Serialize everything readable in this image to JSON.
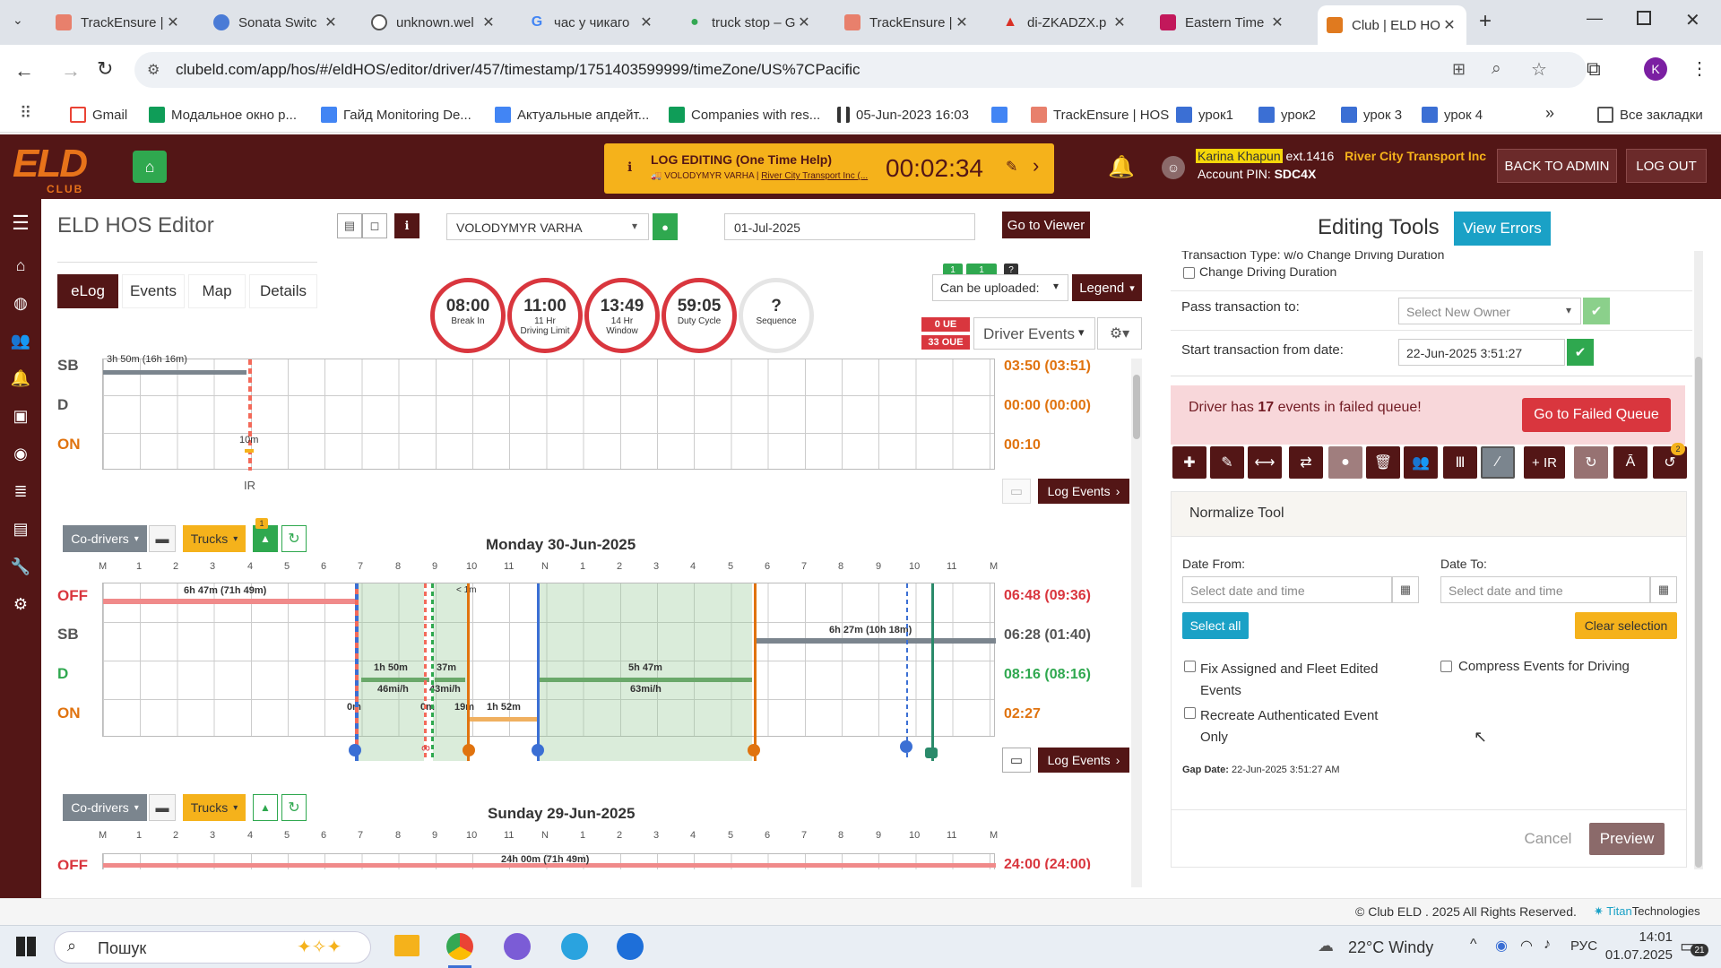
{
  "browser": {
    "tabs": [
      {
        "title": "TrackEnsure |",
        "color": "#e8806c"
      },
      {
        "title": "Sonata Switc",
        "color": "#4a7bd6"
      },
      {
        "title": "unknown.wel",
        "color": "#555555"
      },
      {
        "title": "час у чикаго",
        "color": "#4285f4"
      },
      {
        "title": "truck stop – G",
        "color": "#34a853"
      },
      {
        "title": "TrackEnsure |",
        "color": "#e8806c"
      },
      {
        "title": "di-ZKADZX.p",
        "color": "#d93025"
      },
      {
        "title": "Eastern Time",
        "color": "#c2185b"
      },
      {
        "title": "Club | ELD HO",
        "color": "#e07a1f"
      }
    ],
    "url": "clubeld.com/app/hos/#/eldHOS/editor/driver/457/timestamp/1751403599999/timeZone/US%7CPacific",
    "bookmarks": [
      {
        "label": "Gmail",
        "color": "#ea4335"
      },
      {
        "label": "Модальное окно р...",
        "color": "#0f9d58"
      },
      {
        "label": "Гайд Monitoring De...",
        "color": "#4285f4"
      },
      {
        "label": "Актуальные апдейт...",
        "color": "#4285f4"
      },
      {
        "label": "Companies with res...",
        "color": "#0f9d58"
      },
      {
        "label": "05-Jun-2023 16:03",
        "color": "#333333"
      },
      {
        "label": "",
        "color": "#4285f4"
      },
      {
        "label": "TrackEnsure | HOS",
        "color": "#e8806c"
      },
      {
        "label": "урок1",
        "color": "#3b6fd4"
      },
      {
        "label": "урок2",
        "color": "#3b6fd4"
      },
      {
        "label": "урок 3",
        "color": "#3b6fd4"
      },
      {
        "label": "урок 4",
        "color": "#3b6fd4"
      }
    ],
    "all_bookmarks": "Все закладки"
  },
  "header": {
    "log_editing_title": "LOG EDITING (One Time Help)",
    "log_editing_driver": "VOLODYMYR VARHA",
    "log_editing_company": "River City Transport Inc (...",
    "timer": "00:02:34",
    "user_name": "Karina Khapun",
    "user_ext": "ext.1416",
    "company": "River City Transport Inc",
    "account_pin_label": "Account PIN:",
    "account_pin": "SDC4X",
    "back_to_admin": "BACK TO ADMIN",
    "logout": "LOG OUT"
  },
  "editor": {
    "title": "ELD HOS Editor",
    "driver": "VOLODYMYR VARHA",
    "date": "01-Jul-2025",
    "go_to_viewer": "Go to Viewer",
    "tabs": [
      "eLog",
      "Events",
      "Map",
      "Details"
    ],
    "gauges": [
      {
        "value": "08:00",
        "label": "Break In",
        "l2": ""
      },
      {
        "value": "11:00",
        "label": "11 Hr",
        "l2": "Driving Limit"
      },
      {
        "value": "13:49",
        "label": "14 Hr",
        "l2": "Window"
      },
      {
        "value": "59:05",
        "label": "Duty Cycle",
        "l2": ""
      },
      {
        "value": "?",
        "label": "Sequence",
        "l2": ""
      }
    ],
    "badges": {
      "b1": "1",
      "b2": "1",
      "b3": "?"
    },
    "can_be_uploaded": "Can be uploaded:",
    "legend": "Legend",
    "ue": "0 UE",
    "oue": "33 OUE",
    "driver_events": "Driver Events",
    "top_graph": {
      "rows": [
        "SB",
        "D",
        "ON"
      ],
      "totals": [
        "03:50 (03:51)",
        "00:00 (00:00)",
        "00:10"
      ],
      "labels": {
        "sb_text": "3h 50m (16h 16m)",
        "on_text": "10m",
        "ir": "IR"
      }
    },
    "log_events": "Log Events",
    "co_drivers": "Co-drivers",
    "trucks": "Trucks",
    "notif_badge": "1",
    "day1": {
      "title": "Monday 30-Jun-2025",
      "hours": [
        "M",
        "1",
        "2",
        "3",
        "4",
        "5",
        "6",
        "7",
        "8",
        "9",
        "10",
        "11",
        "N",
        "1",
        "2",
        "3",
        "4",
        "5",
        "6",
        "7",
        "8",
        "9",
        "10",
        "11",
        "M"
      ],
      "rows": [
        "OFF",
        "SB",
        "D",
        "ON"
      ],
      "totals": [
        "06:48 (09:36)",
        "06:28 (01:40)",
        "08:16 (08:16)",
        "02:27"
      ],
      "labels": {
        "off1": "6h 47m (71h 49m)",
        "off2": "< 1m",
        "sb1": "6h 27m (10h 18m)",
        "d1": "1h 50m",
        "d1s": "46mi/h",
        "d2": "37m",
        "d2s": "43mi/h",
        "d3": "5h 47m",
        "d3s": "63mi/h",
        "on1": "0m",
        "on2": "0m",
        "on3": "19m",
        "on4": "1h 52m"
      }
    },
    "day2": {
      "title": "Sunday 29-Jun-2025",
      "off_text": "24h 00m (71h 49m)",
      "off_total": "24:00 (24:00)"
    }
  },
  "tools": {
    "title": "Editing Tools",
    "view_errors": "View Errors",
    "transaction_type": "Transaction Type: w/o Change Driving Duration",
    "change_driving": "Change Driving Duration",
    "pass_to": "Pass transaction to:",
    "select_owner": "Select New Owner",
    "start_from": "Start transaction from date:",
    "start_date": "22-Jun-2025 3:51:27",
    "failed_pre": "Driver has ",
    "failed_count": "17",
    "failed_post": " events in failed queue!",
    "go_failed": "Go to Failed Queue",
    "ir_btn": "+ IR",
    "hist_badge": "2",
    "normalize": "Normalize Tool",
    "date_from": "Date From:",
    "date_to": "Date To:",
    "date_ph": "Select date and time",
    "select_all": "Select all",
    "clear_selection": "Clear selection",
    "opt1": "Fix Assigned and Fleet Edited",
    "opt1b": "Events",
    "opt2": "Compress Events for Driving",
    "opt3": "Recreate Authenticated Event",
    "opt3b": "Only",
    "gap_label": "Gap Date:",
    "gap_value": "22-Jun-2025 3:51:27 AM",
    "cancel": "Cancel",
    "preview": "Preview"
  },
  "footer": {
    "copyright": "© Club ELD . 2025 All Rights Reserved.",
    "brand1": "Titan",
    "brand2": "Technologies"
  },
  "taskbar": {
    "search": "Пошук",
    "weather": "22°C  Windy",
    "lang": "РУС",
    "time": "14:01",
    "date": "01.07.2025",
    "notif": "21"
  }
}
